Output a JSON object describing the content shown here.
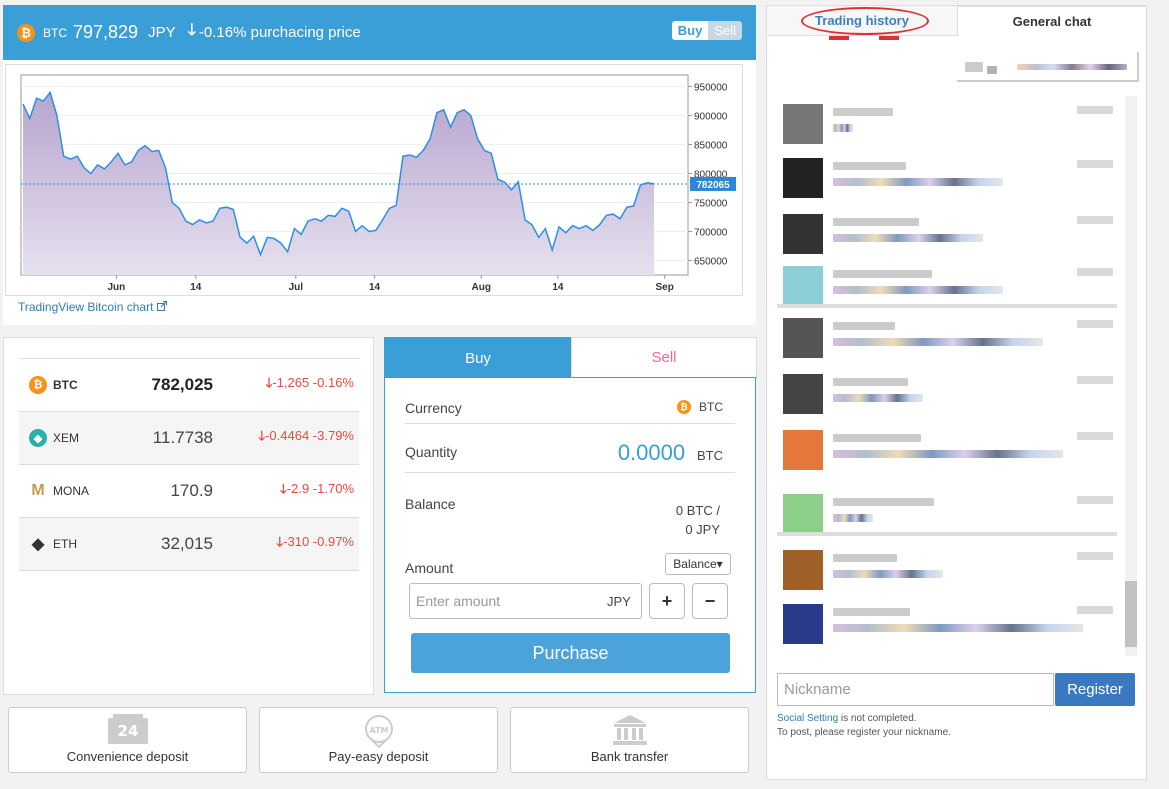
{
  "header": {
    "symbol": "BTC",
    "price": "797,829",
    "currency": "JPY",
    "change": "-0.16%",
    "change_text": "purchacing price",
    "toggle_buy": "Buy",
    "toggle_sell": "Sell"
  },
  "chart_link": "TradingView Bitcoin chart",
  "chart_data": {
    "type": "area",
    "x_ticks": [
      "Jun",
      "14",
      "Jul",
      "14",
      "Aug",
      "14",
      "Sep"
    ],
    "y_ticks": [
      "950000",
      "900000",
      "850000",
      "800000",
      "750000",
      "700000",
      "650000"
    ],
    "ylim": [
      625000,
      970000
    ],
    "current_price_label": "782065",
    "current_price": 782065,
    "values": [
      920000,
      895000,
      930000,
      925000,
      940000,
      900000,
      830000,
      825000,
      830000,
      810000,
      800000,
      815000,
      808000,
      820000,
      835000,
      815000,
      820000,
      840000,
      848000,
      838000,
      840000,
      810000,
      750000,
      740000,
      718000,
      712000,
      720000,
      715000,
      718000,
      740000,
      742000,
      738000,
      690000,
      680000,
      692000,
      660000,
      690000,
      688000,
      680000,
      665000,
      705000,
      695000,
      718000,
      722000,
      718000,
      728000,
      726000,
      740000,
      735000,
      700000,
      710000,
      700000,
      702000,
      720000,
      740000,
      745000,
      830000,
      832000,
      828000,
      840000,
      860000,
      905000,
      910000,
      880000,
      905000,
      910000,
      900000,
      860000,
      840000,
      835000,
      790000,
      785000,
      772000,
      786000,
      720000,
      712000,
      690000,
      705000,
      668000,
      708000,
      698000,
      710000,
      705000,
      710000,
      702000,
      712000,
      728000,
      730000,
      722000,
      742000,
      744000,
      780000,
      784000,
      782065
    ]
  },
  "prices": [
    {
      "coin": "BTC",
      "icon": "bitcoin-icon",
      "value": "782,025",
      "change": "-1,265 -0.16%",
      "color": "#f7931a"
    },
    {
      "coin": "XEM",
      "icon": "nem-icon",
      "value": "11.7738",
      "change": "-0.4464 -3.79%",
      "color": "#2ab0a7"
    },
    {
      "coin": "MONA",
      "icon": "monacoin-icon",
      "value": "170.9",
      "change": "-2.9 -1.70%",
      "color": "#c59b57"
    },
    {
      "coin": "ETH",
      "icon": "ethereum-icon",
      "value": "32,015",
      "change": "-310 -0.97%",
      "color": "#333333"
    }
  ],
  "order": {
    "tab_buy": "Buy",
    "tab_sell": "Sell",
    "currency_label": "Currency",
    "currency_value": "BTC",
    "quantity_label": "Quantity",
    "quantity_value": "0.0000",
    "quantity_unit": "BTC",
    "balance_label": "Balance",
    "balance_btc": "0 BTC /",
    "balance_jpy": "0 JPY",
    "amount_label": "Amount",
    "balance_dropdown": "Balance▾",
    "amount_placeholder": "Enter amount",
    "amount_unit": "JPY",
    "plus": "+",
    "minus": "−",
    "purchase": "Purchase"
  },
  "deposits": [
    {
      "label": "Convenience deposit",
      "icon": "store-24-icon"
    },
    {
      "label": "Pay-easy deposit",
      "icon": "atm-icon"
    },
    {
      "label": "Bank transfer",
      "icon": "bank-icon"
    }
  ],
  "chat": {
    "tab_history": "Trading history",
    "tab_chat": "General chat",
    "nickname_placeholder": "Nickname",
    "register": "Register",
    "social_link": "Social Setting",
    "social_text": " is not completed.",
    "post_note": "To post, please register your nickname."
  },
  "colors": {
    "accent": "#3a9fd6",
    "down": "#e74c3c",
    "chart_line": "#2d8fe0",
    "chart_fill": "#cfc3de"
  }
}
